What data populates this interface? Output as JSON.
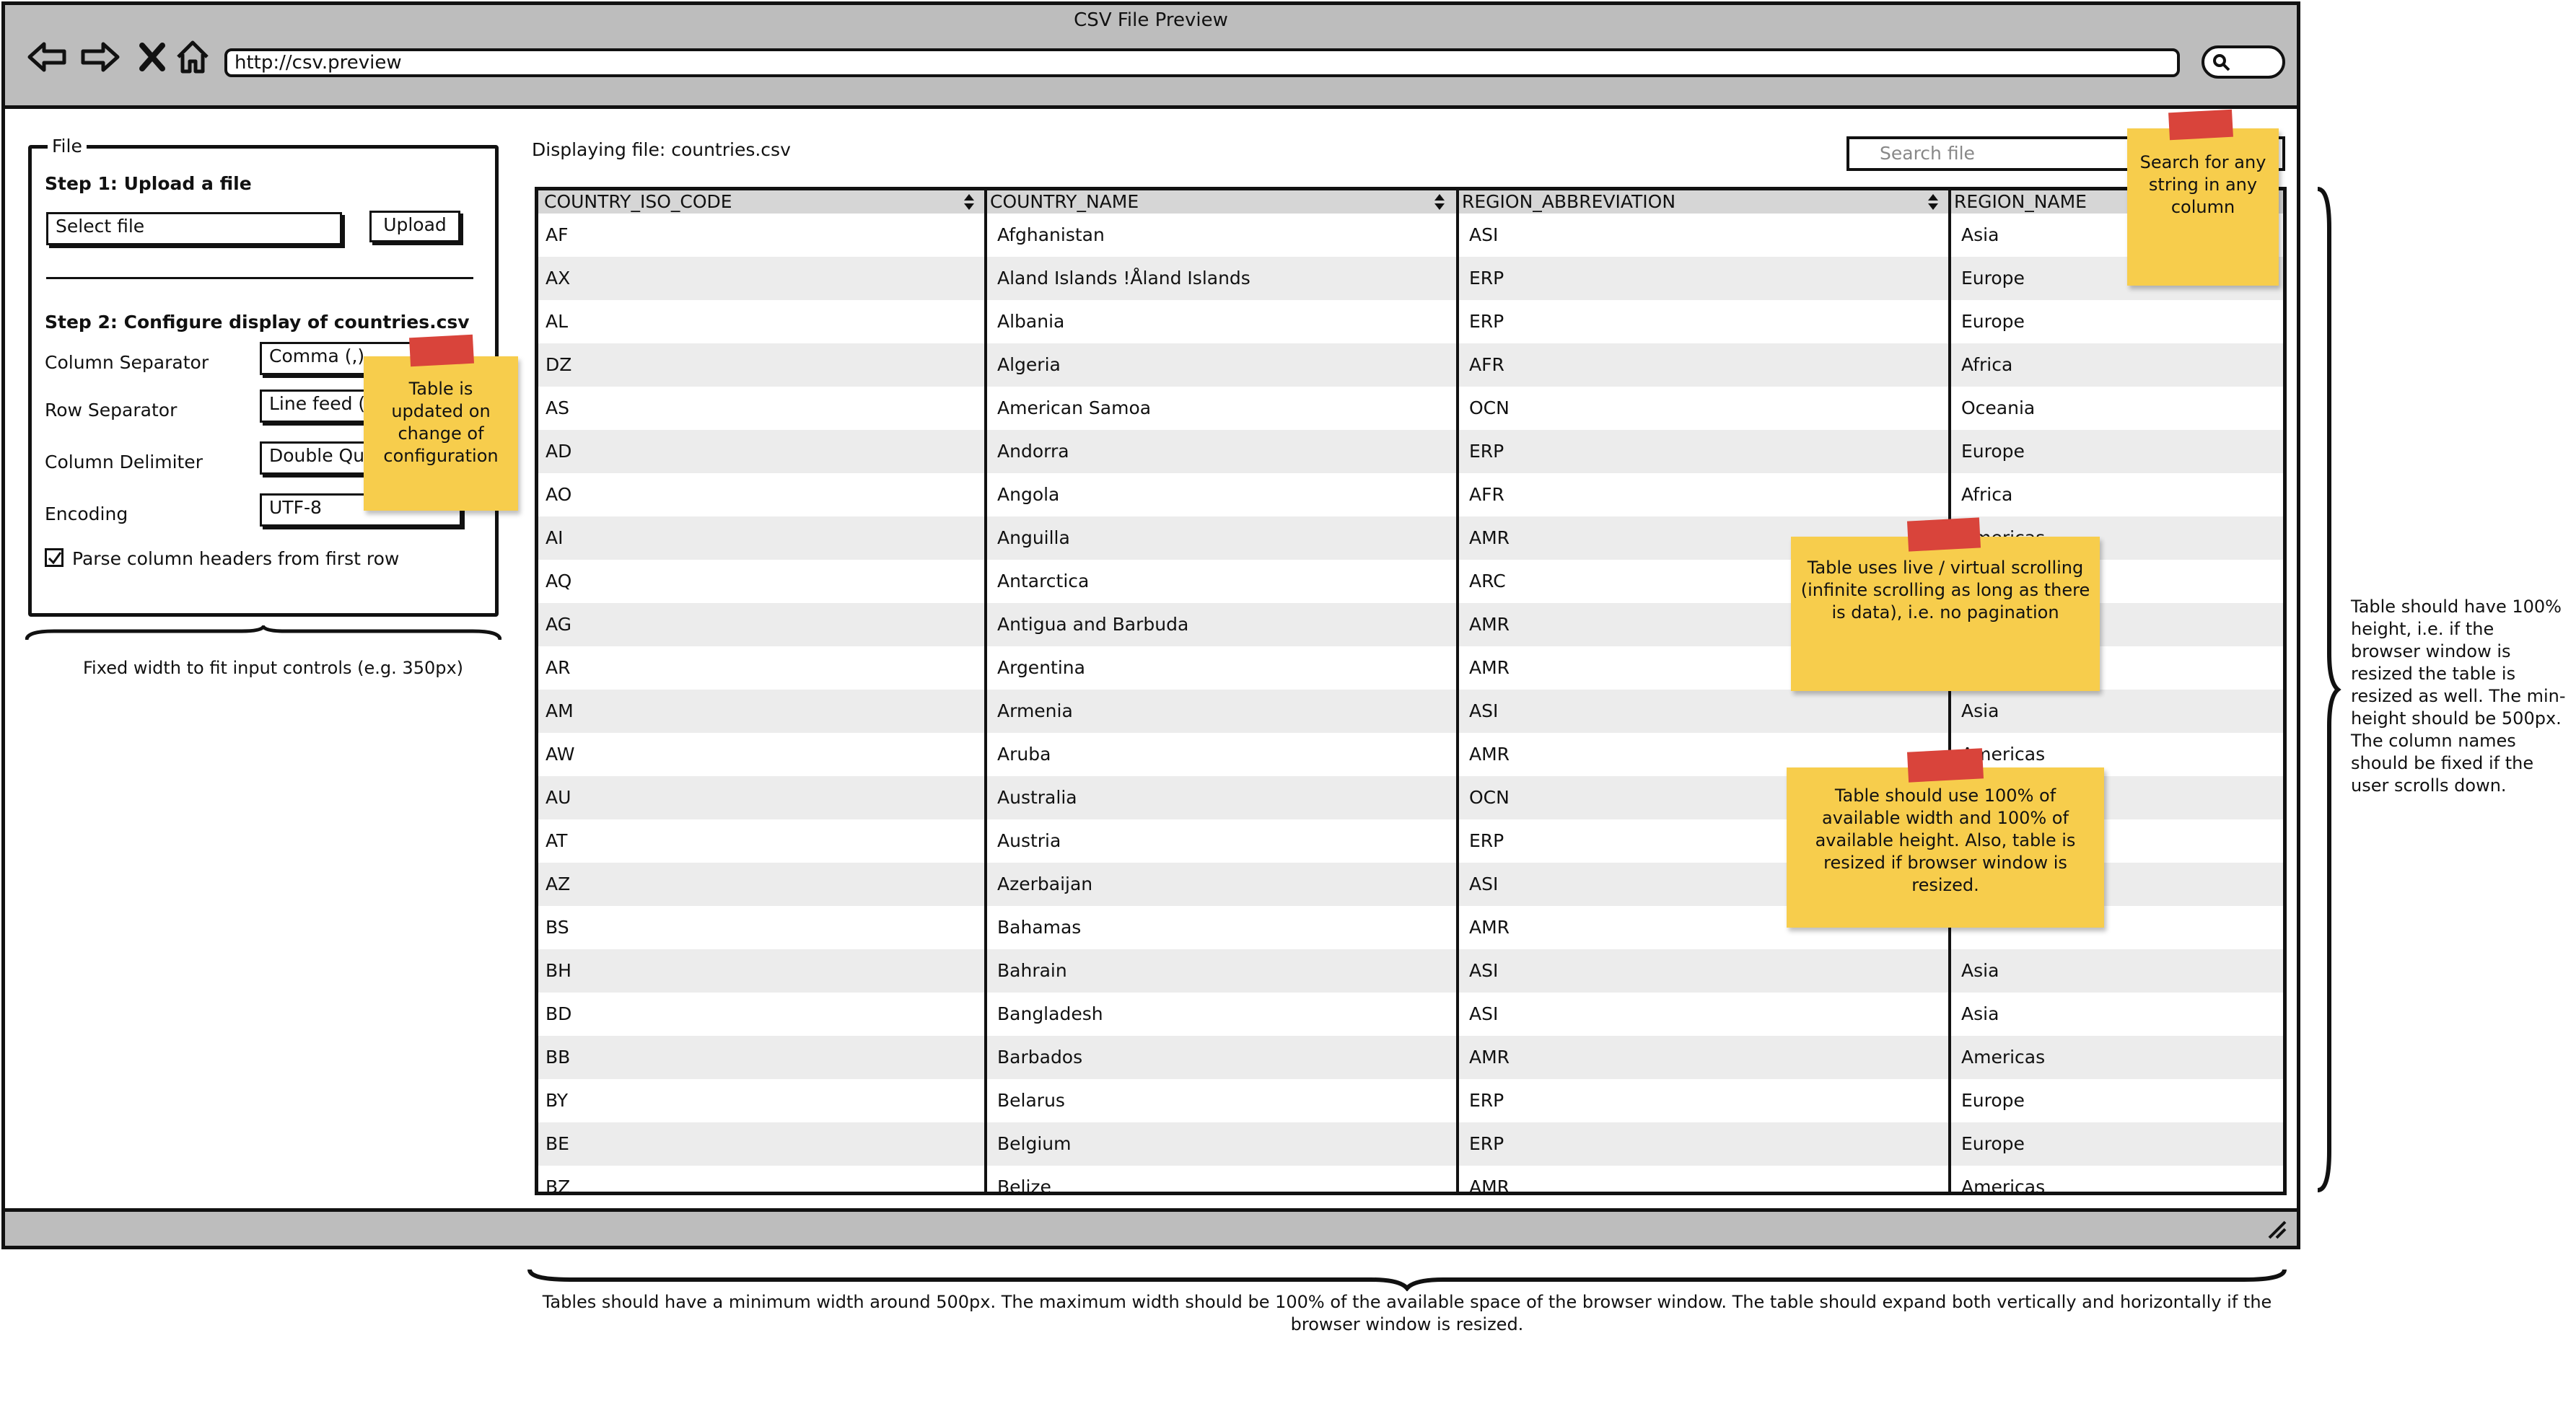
{
  "window": {
    "title": "CSV File Preview",
    "url": "http://csv.preview"
  },
  "sidebar": {
    "legend": "File",
    "step1_label": "Step 1: Upload a file",
    "file_input_value": "Select file",
    "upload_label": "Upload",
    "step2_label": "Step 2: Configure display of countries.csv",
    "column_separator_label": "Column Separator",
    "column_separator_value": "Comma (,)",
    "row_separator_label": "Row Separator",
    "row_separator_value": "Line feed (LF)",
    "column_delimiter_label": "Column Delimiter",
    "column_delimiter_value": "Double Quote (\")",
    "encoding_label": "Encoding",
    "encoding_value": "UTF-8",
    "parse_headers_label": "Parse column headers from first row",
    "parse_headers_checked": true,
    "width_note": "Fixed width to fit input controls (e.g. 350px)"
  },
  "main": {
    "displaying_file": "Displaying file: countries.csv",
    "search_placeholder": "Search file"
  },
  "table": {
    "columns": [
      "COUNTRY_ISO_CODE",
      "COUNTRY_NAME",
      "REGION_ABBREVIATION",
      "REGION_NAME"
    ],
    "rows": [
      [
        "AF",
        "Afghanistan",
        "ASI",
        "Asia"
      ],
      [
        "AX",
        "Aland Islands !Åland Islands",
        "ERP",
        "Europe"
      ],
      [
        "AL",
        "Albania",
        "ERP",
        "Europe"
      ],
      [
        "DZ",
        "Algeria",
        "AFR",
        "Africa"
      ],
      [
        "AS",
        "American Samoa",
        "OCN",
        "Oceania"
      ],
      [
        "AD",
        "Andorra",
        "ERP",
        "Europe"
      ],
      [
        "AO",
        "Angola",
        "AFR",
        "Africa"
      ],
      [
        "AI",
        "Anguilla",
        "AMR",
        "Americas"
      ],
      [
        "AQ",
        "Antarctica",
        "ARC",
        ""
      ],
      [
        "AG",
        "Antigua and Barbuda",
        "AMR",
        ""
      ],
      [
        "AR",
        "Argentina",
        "AMR",
        ""
      ],
      [
        "AM",
        "Armenia",
        "ASI",
        "Asia"
      ],
      [
        "AW",
        "Aruba",
        "AMR",
        "Americas"
      ],
      [
        "AU",
        "Australia",
        "OCN",
        ""
      ],
      [
        "AT",
        "Austria",
        "ERP",
        ""
      ],
      [
        "AZ",
        "Azerbaijan",
        "ASI",
        ""
      ],
      [
        "BS",
        "Bahamas",
        "AMR",
        ""
      ],
      [
        "BH",
        "Bahrain",
        "ASI",
        "Asia"
      ],
      [
        "BD",
        "Bangladesh",
        "ASI",
        "Asia"
      ],
      [
        "BB",
        "Barbados",
        "AMR",
        "Americas"
      ],
      [
        "BY",
        "Belarus",
        "ERP",
        "Europe"
      ],
      [
        "BE",
        "Belgium",
        "ERP",
        "Europe"
      ],
      [
        "BZ",
        "Belize",
        "AMR",
        "Americas"
      ]
    ]
  },
  "notes": {
    "config": "Table is updated on change of configuration",
    "search": "Search for any string in any column",
    "scrolling": "Table uses live / virtual scrolling (infinite scrolling as long as there is data), i.e. no pagination",
    "width": "Table should use 100% of available width and 100% of available height. Also, table is resized if browser window is resized.",
    "height": "Table should have 100% height, i.e. if the browser window is resized the table is resized as well. The min-height should be 500px. The column names should be fixed if the user scrolls down.",
    "bottom": "Tables should have a minimum width around 500px. The maximum width should be 100% of the available space of the browser window. The table should expand both vertically and horizontally if the browser window is resized."
  },
  "colors": {
    "sticky_note": "#f7cd4c",
    "tape": "#d9443b",
    "chrome": "#bdbdbd",
    "row_stripe": "#ececec"
  }
}
